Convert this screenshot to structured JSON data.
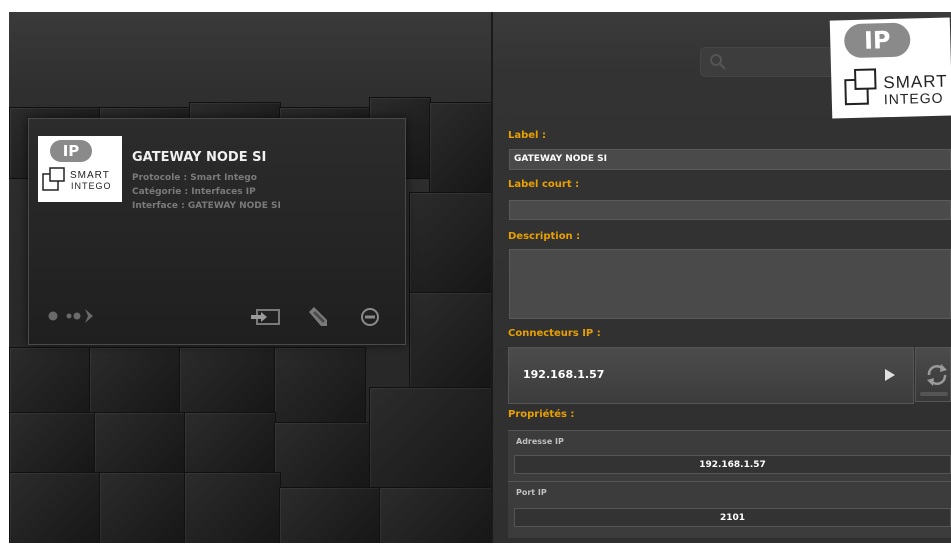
{
  "card": {
    "title": "GATEWAY NODE SI",
    "protocol": "Protocole : Smart Intego",
    "category": "Catégorie : Interfaces IP",
    "interface": "Interface : GATEWAY NODE SI"
  },
  "logo": {
    "ip": "IP",
    "smart": "SMART",
    "intego": "INTEGO"
  },
  "form": {
    "label_title": "Label :",
    "label_value": "GATEWAY NODE SI",
    "short_label_title": "Label court :",
    "short_label_value": "",
    "description_title": "Description :",
    "description_value": "",
    "connectors_title": "Connecteurs IP :",
    "connector_value": "192.168.1.57",
    "properties_title": "Propriétés :",
    "properties": [
      {
        "label": "Adresse IP",
        "value": "192.168.1.57"
      },
      {
        "label": "Port IP",
        "value": "2101"
      }
    ]
  },
  "colors": {
    "accent": "#e8a000",
    "background": "#2b2b2b"
  }
}
